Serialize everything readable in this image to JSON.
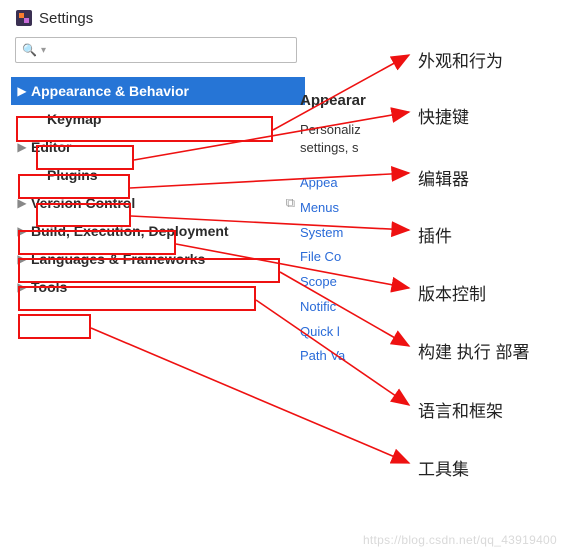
{
  "title": "Settings",
  "search_placeholder": "",
  "tree": {
    "appearance": "Appearance & Behavior",
    "keymap": "Keymap",
    "editor": "Editor",
    "plugins": "Plugins",
    "version_control": "Version Control",
    "build": "Build, Execution, Deployment",
    "languages": "Languages & Frameworks",
    "tools": "Tools"
  },
  "right_pane": {
    "heading": "Appearar",
    "subtext": "Personaliz\nsettings, s",
    "links": [
      "Appea",
      "Menus",
      "System",
      "File Co",
      "Scope",
      "Notific",
      "Quick l",
      "Path Va"
    ]
  },
  "annotations": {
    "a0": "外观和行为",
    "a1": "快捷键",
    "a2": "编辑器",
    "a3": "插件",
    "a4": "版本控制",
    "a5": "构建 执行 部署",
    "a6": "语言和框架",
    "a7": "工具集"
  },
  "watermark": "https://blog.csdn.net/qq_43919400",
  "icons": {
    "search": "🔍",
    "dropdown": "▾"
  }
}
